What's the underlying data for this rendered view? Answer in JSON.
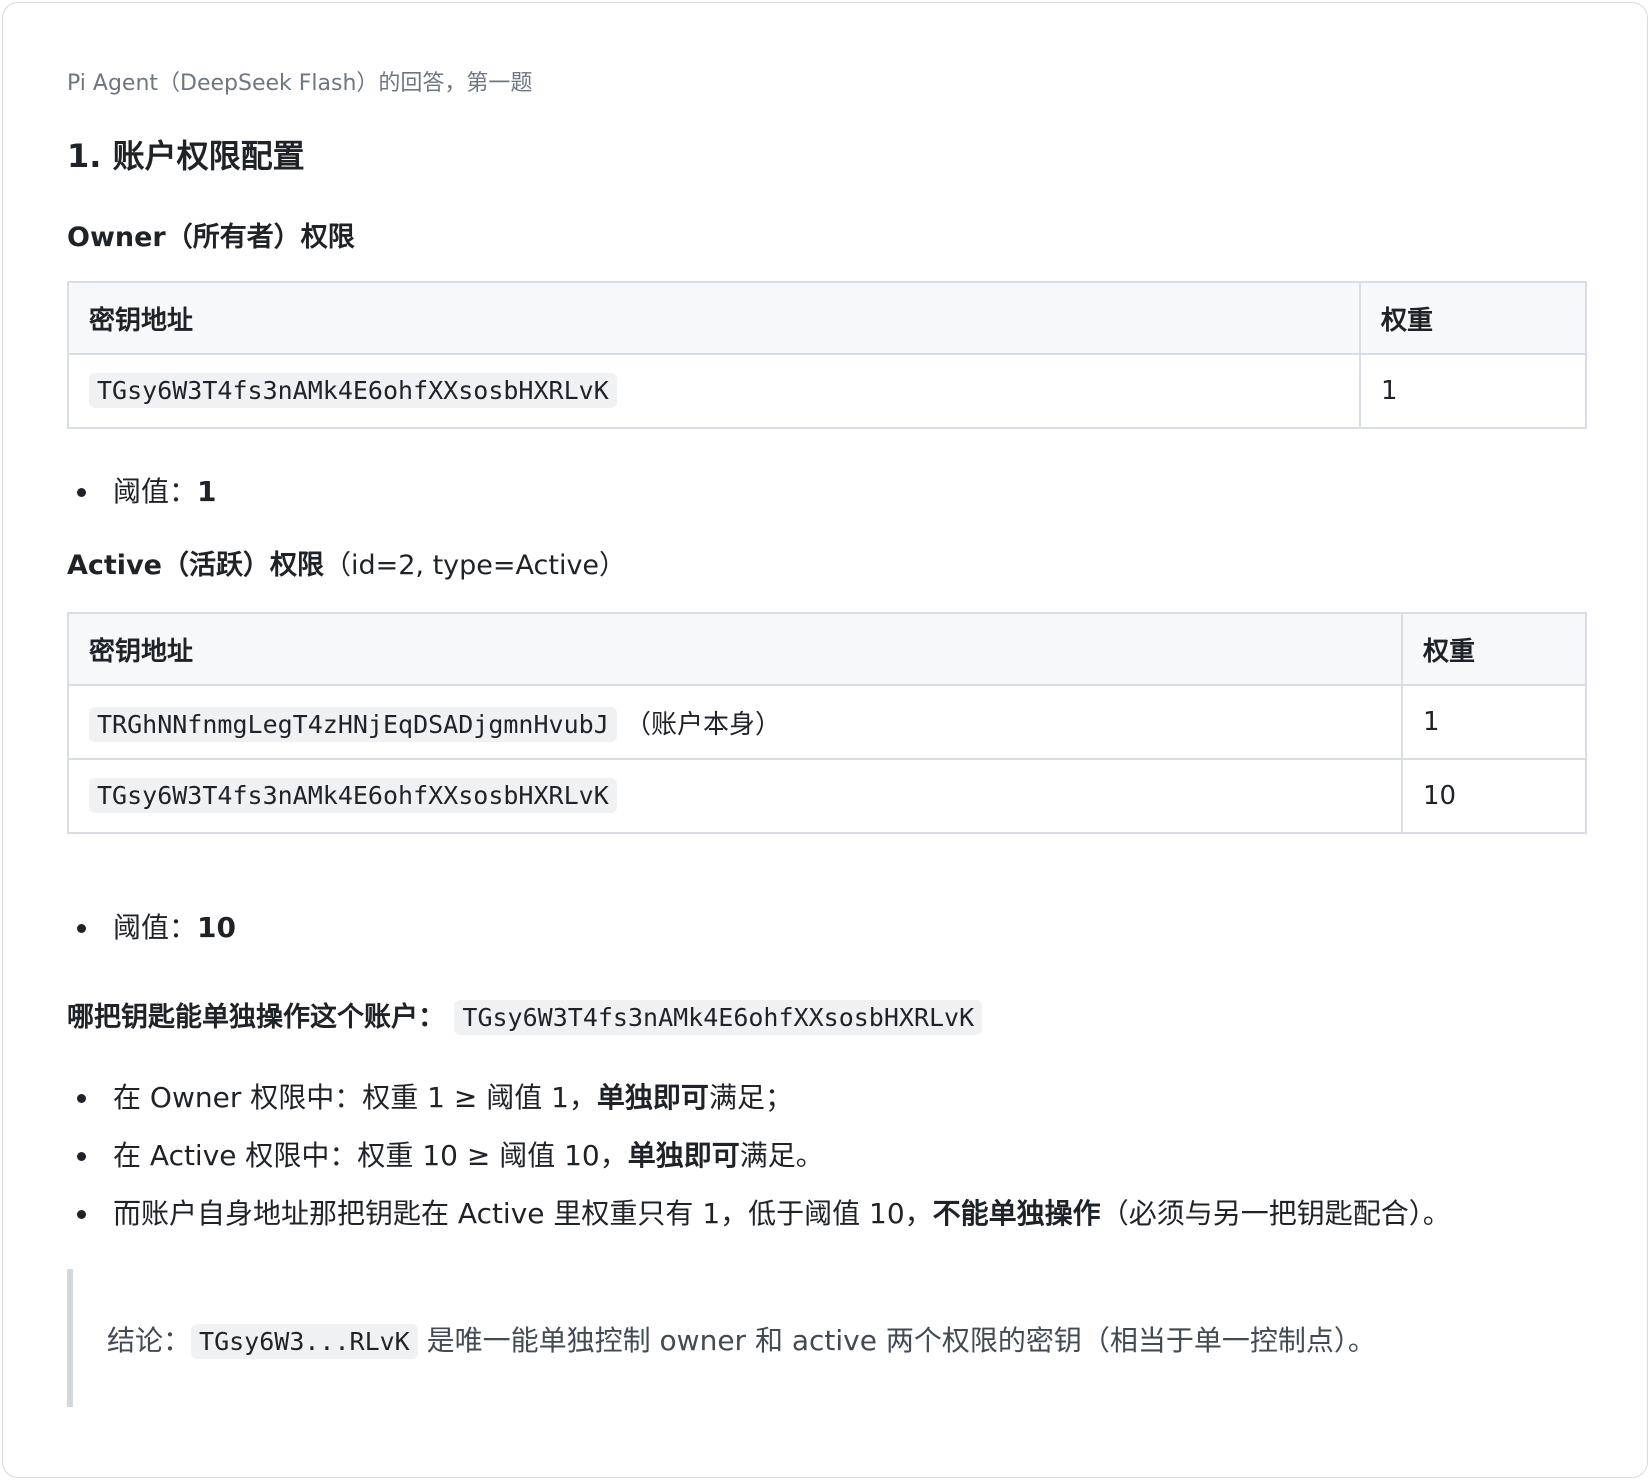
{
  "caption": "Pi Agent（DeepSeek Flash）的回答，第一题",
  "title": "1. 账户权限配置",
  "owner_section": {
    "heading": "Owner（所有者）权限",
    "table": {
      "headers": [
        "密钥地址",
        "权重"
      ],
      "rows": [
        {
          "address": "TGsy6W3T4fs3nAMk4E6ohfXXsosbHXRLvK",
          "note": "",
          "weight": "1"
        }
      ]
    },
    "threshold_label": "阈值：",
    "threshold_value": "1"
  },
  "active_section": {
    "heading_bold": "Active（活跃）权限",
    "heading_normal": "（id=2, type=Active）",
    "table": {
      "headers": [
        "密钥地址",
        "权重"
      ],
      "rows": [
        {
          "address": "TRGhNNfnmgLegT4zHNjEqDSADjgmnHvubJ",
          "note": "（账户本身）",
          "weight": "1"
        },
        {
          "address": "TGsy6W3T4fs3nAMk4E6ohfXXsosbHXRLvK",
          "note": "",
          "weight": "10"
        }
      ]
    },
    "threshold_label": "阈值：",
    "threshold_value": "10"
  },
  "single_key": {
    "question": "哪把钥匙能单独操作这个账户：",
    "answer_code": "TGsy6W3T4fs3nAMk4E6ohfXXsosbHXRLvK",
    "bullets": [
      {
        "pre": "在 Owner 权限中：权重 1 ≥ 阈值 1，",
        "bold": "单独即可",
        "post": "满足；"
      },
      {
        "pre": "在 Active 权限中：权重 10 ≥ 阈值 10，",
        "bold": "单独即可",
        "post": "满足。"
      },
      {
        "pre": "而账户自身地址那把钥匙在 Active 里权重只有 1，低于阈值 10，",
        "bold": "不能单独操作",
        "post": "（必须与另一把钥匙配合）。"
      }
    ]
  },
  "conclusion": {
    "label": "结论：",
    "code": "TGsy6W3...RLvK",
    "text": "是唯一能单独控制 owner 和 active 两个权限的密钥（相当于单一控制点）。"
  }
}
